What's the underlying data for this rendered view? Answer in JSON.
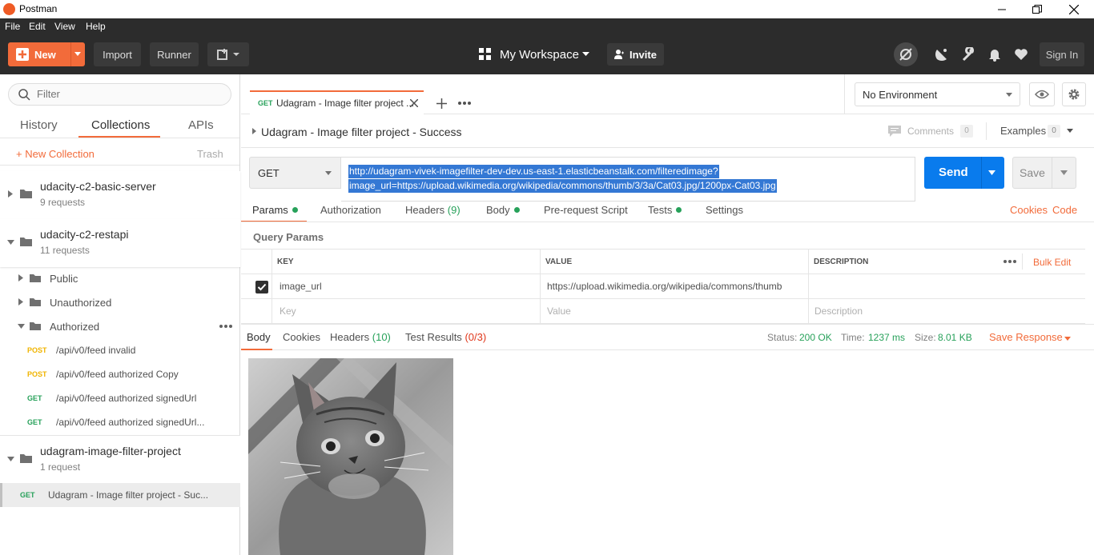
{
  "app": {
    "title": "Postman"
  },
  "menu": [
    "File",
    "Edit",
    "View",
    "Help"
  ],
  "header": {
    "new_label": "New",
    "import_label": "Import",
    "runner_label": "Runner",
    "workspace_label": "My Workspace",
    "invite_label": "Invite",
    "signin_label": "Sign In"
  },
  "sidebar": {
    "filter_placeholder": "Filter",
    "tabs": [
      "History",
      "Collections",
      "APIs"
    ],
    "new_collection": "+ New Collection",
    "trash": "Trash",
    "collections": [
      {
        "name": "udacity-c2-basic-server",
        "requests": "9 requests"
      },
      {
        "name": "udacity-c2-restapi",
        "requests": "11 requests"
      },
      {
        "name": "udagram-image-filter-project",
        "requests": "1 request"
      }
    ],
    "folders": [
      "Public",
      "Unauthorized",
      "Authorized"
    ],
    "requests": [
      {
        "method": "POST",
        "name": "/api/v0/feed invalid"
      },
      {
        "method": "POST",
        "name": "/api/v0/feed authorized Copy"
      },
      {
        "method": "GET",
        "name": "/api/v0/feed authorized signedUrl"
      },
      {
        "method": "GET",
        "name": "/api/v0/feed authorized signedUrl..."
      }
    ],
    "selected_request": {
      "method": "GET",
      "name": "Udagram - Image filter project - Suc..."
    }
  },
  "tab": {
    "method": "GET",
    "title": "Udagram - Image filter project ..."
  },
  "environment": {
    "selected": "No Environment"
  },
  "request": {
    "title": "Udagram - Image filter project - Success",
    "comments_label": "Comments",
    "comments_count": "0",
    "examples_label": "Examples",
    "examples_count": "0",
    "method": "GET",
    "url_line1": "http://udagram-vivek-imagefilter-dev-dev.us-east-1.elasticbeanstalk.com/filteredimage?",
    "url_line2": "image_url=https://upload.wikimedia.org/wikipedia/commons/thumb/3/3a/Cat03.jpg/1200px-Cat03.jpg",
    "send_label": "Send",
    "save_label": "Save"
  },
  "params_tabs": {
    "params": "Params",
    "authorization": "Authorization",
    "headers": "Headers",
    "headers_count": "(9)",
    "body": "Body",
    "prerequest": "Pre-request Script",
    "tests": "Tests",
    "settings": "Settings",
    "cookies": "Cookies",
    "code": "Code"
  },
  "query_params": {
    "title": "Query Params",
    "columns": {
      "key": "KEY",
      "value": "VALUE",
      "description": "DESCRIPTION"
    },
    "bulk_edit": "Bulk Edit",
    "rows": [
      {
        "key": "image_url",
        "value": "https://upload.wikimedia.org/wikipedia/commons/thumb",
        "checked": true
      }
    ],
    "placeholders": {
      "key": "Key",
      "value": "Value",
      "description": "Description"
    }
  },
  "response": {
    "tabs": {
      "body": "Body",
      "cookies": "Cookies",
      "headers": "Headers",
      "headers_count": "(10)",
      "tests": "Test Results",
      "tests_count": "(0/3)"
    },
    "status_label": "Status:",
    "status_value": "200 OK",
    "time_label": "Time:",
    "time_value": "1237 ms",
    "size_label": "Size:",
    "size_value": "8.01 KB",
    "save_response": "Save Response"
  }
}
